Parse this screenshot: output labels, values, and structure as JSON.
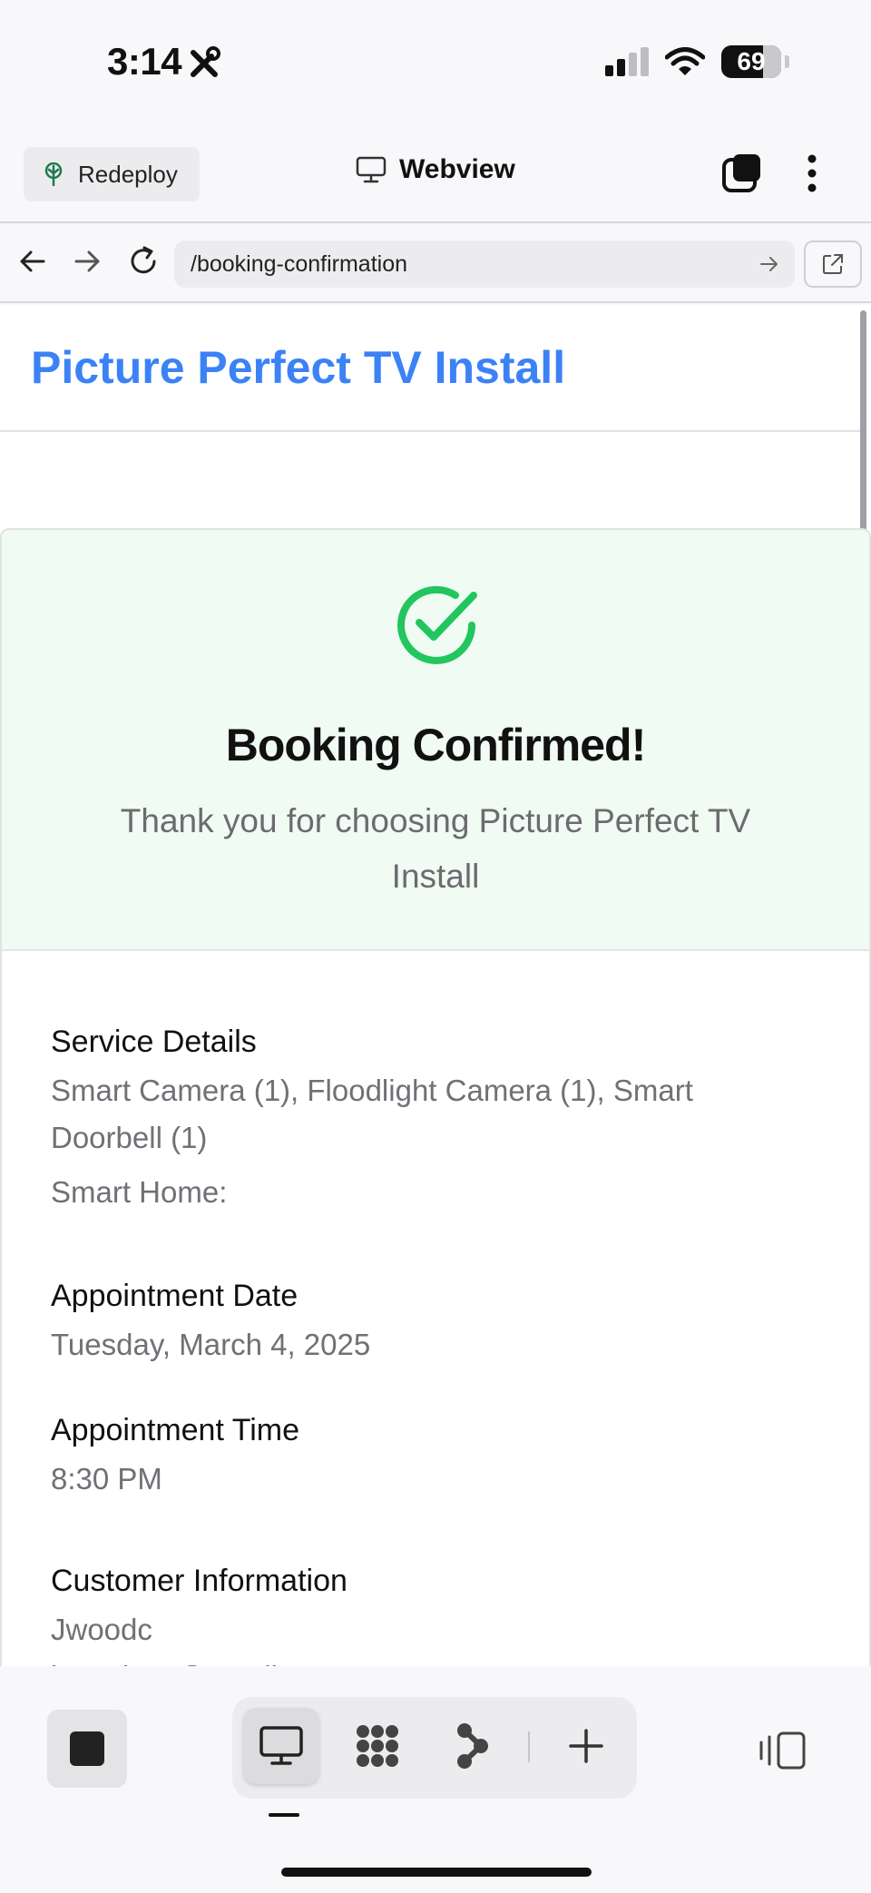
{
  "status_bar": {
    "time": "3:14",
    "battery": "69"
  },
  "toolbar": {
    "redeploy_label": "Redeploy",
    "webview_title": "Webview"
  },
  "browser": {
    "url": "/booking-confirmation"
  },
  "site": {
    "title": "Picture Perfect TV Install"
  },
  "confirmation": {
    "title": "Booking Confirmed!",
    "subtitle": "Thank you for choosing Picture Perfect TV Install"
  },
  "details": {
    "service": {
      "label": "Service Details",
      "items": "Smart Camera (1), Floodlight Camera (1), Smart Doorbell (1)",
      "smart_home": "Smart Home:"
    },
    "date": {
      "label": "Appointment Date",
      "value": "Tuesday, March 4, 2025"
    },
    "time": {
      "label": "Appointment Time",
      "value": "8:30 PM"
    },
    "customer": {
      "label": "Customer Information",
      "name": "Jwoodc",
      "email": "jwoodcox@gmail.com"
    }
  },
  "colors": {
    "brand": "#3b82f6",
    "success": "#22c55e",
    "success_bg": "#effbf3"
  },
  "icons": [
    "wrench-screwdriver-icon",
    "signal-icon",
    "wifi-icon",
    "battery-icon",
    "tree-icon",
    "monitor-icon",
    "tabs-icon",
    "more-vertical-icon",
    "back-arrow-icon",
    "forward-arrow-icon",
    "reload-icon",
    "go-arrow-icon",
    "external-link-icon",
    "check-circle-icon",
    "stop-icon",
    "desktop-icon",
    "grid-blob-icon",
    "flow-icon",
    "plus-icon",
    "panel-toggle-icon"
  ]
}
